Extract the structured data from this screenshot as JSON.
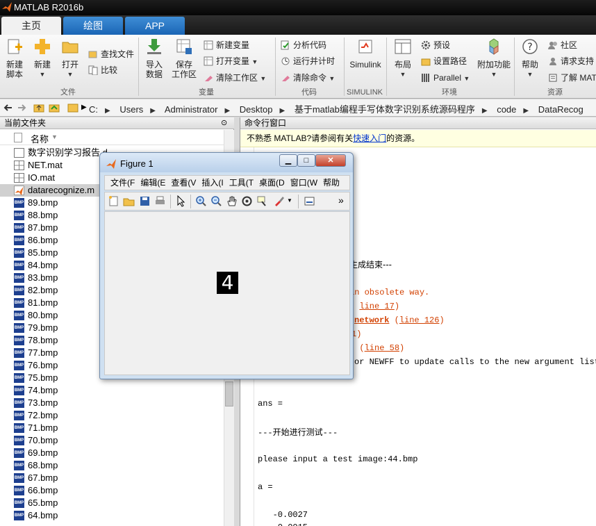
{
  "window": {
    "title": "MATLAB R2016b"
  },
  "tabs": [
    {
      "label": "主页",
      "active": true
    },
    {
      "label": "绘图",
      "active": false
    },
    {
      "label": "APP",
      "active": false
    }
  ],
  "ribbon": {
    "file": {
      "new_script": "新建\n脚本",
      "new": "新建",
      "open": "打开",
      "find_files": "查找文件",
      "compare": "比较",
      "group": "文件"
    },
    "variable": {
      "import": "导入\n数据",
      "save_ws": "保存\n工作区",
      "new_var": "新建变量",
      "open_var": "打开变量",
      "clear_ws": "清除工作区",
      "group": "变量"
    },
    "code": {
      "analyze": "分析代码",
      "run_time": "运行并计时",
      "clear_cmd": "清除命令",
      "group": "代码"
    },
    "simulink": {
      "label": "Simulink",
      "group": "SIMULINK"
    },
    "env": {
      "layout": "布局",
      "prefs": "预设",
      "set_path": "设置路径",
      "parallel": "Parallel",
      "group": "环境"
    },
    "addons": {
      "label": "附加功能"
    },
    "resources": {
      "help": "帮助",
      "community": "社区",
      "support": "请求支持",
      "learn": "了解 MAT",
      "group": "资源"
    }
  },
  "address": {
    "crumbs": [
      "C:",
      "Users",
      "Administrator",
      "Desktop",
      "基于matlab编程手写体数字识别系统源码程序",
      "code",
      "DataRecog"
    ]
  },
  "left_panel": {
    "title": "当前文件夹",
    "col_name": "名称",
    "files": [
      {
        "name": "数字识别学习报告.d",
        "type": "doc"
      },
      {
        "name": "NET.mat",
        "type": "mat"
      },
      {
        "name": "IO.mat",
        "type": "mat"
      },
      {
        "name": "datarecognize.m",
        "type": "m"
      },
      {
        "name": "89.bmp",
        "type": "bmp"
      },
      {
        "name": "88.bmp",
        "type": "bmp"
      },
      {
        "name": "87.bmp",
        "type": "bmp"
      },
      {
        "name": "86.bmp",
        "type": "bmp"
      },
      {
        "name": "85.bmp",
        "type": "bmp"
      },
      {
        "name": "84.bmp",
        "type": "bmp"
      },
      {
        "name": "83.bmp",
        "type": "bmp"
      },
      {
        "name": "82.bmp",
        "type": "bmp"
      },
      {
        "name": "81.bmp",
        "type": "bmp"
      },
      {
        "name": "80.bmp",
        "type": "bmp"
      },
      {
        "name": "79.bmp",
        "type": "bmp"
      },
      {
        "name": "78.bmp",
        "type": "bmp"
      },
      {
        "name": "77.bmp",
        "type": "bmp"
      },
      {
        "name": "76.bmp",
        "type": "bmp"
      },
      {
        "name": "75.bmp",
        "type": "bmp"
      },
      {
        "name": "74.bmp",
        "type": "bmp"
      },
      {
        "name": "73.bmp",
        "type": "bmp"
      },
      {
        "name": "72.bmp",
        "type": "bmp"
      },
      {
        "name": "71.bmp",
        "type": "bmp"
      },
      {
        "name": "70.bmp",
        "type": "bmp"
      },
      {
        "name": "69.bmp",
        "type": "bmp"
      },
      {
        "name": "68.bmp",
        "type": "bmp"
      },
      {
        "name": "67.bmp",
        "type": "bmp"
      },
      {
        "name": "66.bmp",
        "type": "bmp"
      },
      {
        "name": "65.bmp",
        "type": "bmp"
      },
      {
        "name": "64.bmp",
        "type": "bmp"
      }
    ]
  },
  "command_window": {
    "title": "命令行窗口",
    "tip_pre": "不熟悉 MATLAB?请参阅有关",
    "tip_link": "快速入门",
    "tip_post": "的资源。",
    "lines": {
      "gen_end": "生成结束---",
      "obsolete": "an obsolete way.",
      "l17": "line 17",
      "network": "network",
      "l126": "line 126",
      "paren1": "1)",
      "l58": "line 58",
      "newff": "or NEWFF to update calls to the new argument list.",
      "ans": "ans =",
      "start_test": "---开始进行测试---",
      "please_input": "please input a test image:44.bmp",
      "a_eq": "a =",
      "val1": "   -0.0027",
      "val2": "   -0.0015"
    }
  },
  "figure": {
    "title": "Figure 1",
    "menu": [
      "文件(F",
      "编辑(E",
      "查看(V",
      "插入(I",
      "工具(T",
      "桌面(D",
      "窗口(W",
      "帮助(H"
    ],
    "digit": "4"
  }
}
